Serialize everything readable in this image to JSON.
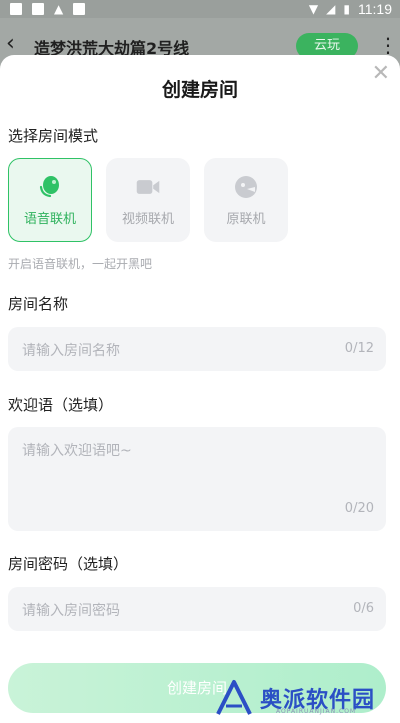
{
  "status_bar": {
    "time": "11:19"
  },
  "app_bar": {
    "title": "造梦洪荒大劫篇2号线",
    "cloud_button": "云玩"
  },
  "sheet": {
    "title": "创建房间",
    "mode_section_label": "选择房间模式",
    "modes": [
      {
        "label": "语音联机",
        "icon": "microphone-icon",
        "selected": true
      },
      {
        "label": "视频联机",
        "icon": "video-camera-icon",
        "selected": false
      },
      {
        "label": "原联机",
        "icon": "gamepad-icon",
        "selected": false
      }
    ],
    "mode_hint": "开启语音联机，一起开黑吧",
    "room_name": {
      "label": "房间名称",
      "placeholder": "请输入房间名称",
      "count": "0/12"
    },
    "welcome": {
      "label": "欢迎语（选填）",
      "placeholder": "请输入欢迎语吧~",
      "count": "0/20"
    },
    "password": {
      "label": "房间密码（选填）",
      "placeholder": "请输入房间密码",
      "count": "0/6"
    },
    "create_button": "创建房间"
  },
  "watermark": {
    "text": "奥派软件园",
    "subtext": "AOPAIRUANJIAN.COM"
  },
  "colors": {
    "accent": "#2fc266",
    "field_bg": "#f3f4f6",
    "cloud_button": "#3bb35f"
  }
}
